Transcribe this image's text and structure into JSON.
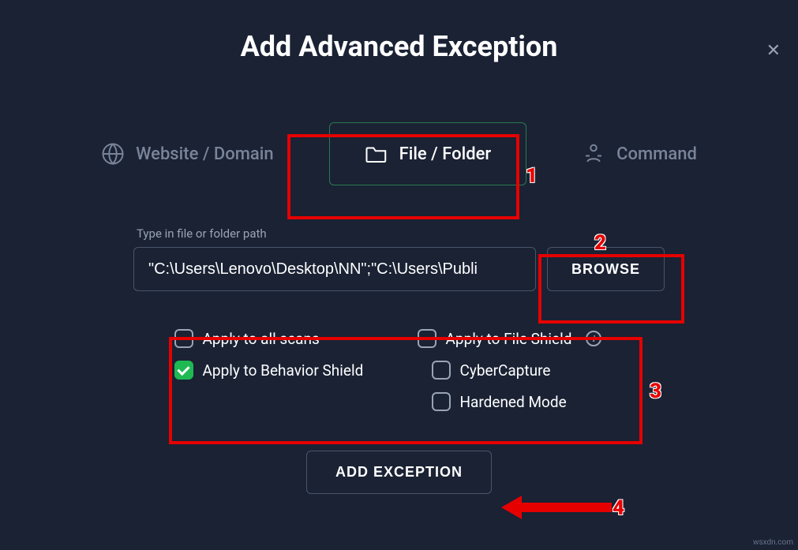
{
  "title": "Add Advanced Exception",
  "tabs": {
    "website": "Website / Domain",
    "file": "File / Folder",
    "command": "Command"
  },
  "path": {
    "label": "Type in file or folder path",
    "value": "\"C:\\Users\\Lenovo\\Desktop\\NN\";\"C:\\Users\\Publi"
  },
  "buttons": {
    "browse": "BROWSE",
    "submit": "ADD EXCEPTION"
  },
  "options": {
    "all_scans": "Apply to all scans",
    "file_shield": "Apply to File Shield",
    "behavior_shield": "Apply to Behavior Shield",
    "cybercapture": "CyberCapture",
    "hardened_mode": "Hardened Mode"
  },
  "checked": {
    "all_scans": false,
    "file_shield": false,
    "behavior_shield": true,
    "cybercapture": false,
    "hardened_mode": false
  },
  "annotations": {
    "n1": "1",
    "n2": "2",
    "n3": "3",
    "n4": "4"
  },
  "colors": {
    "accent_green": "#1fb954",
    "highlight_red": "#e60000",
    "bg": "#1a2234"
  },
  "watermark": "wsxdn.com"
}
